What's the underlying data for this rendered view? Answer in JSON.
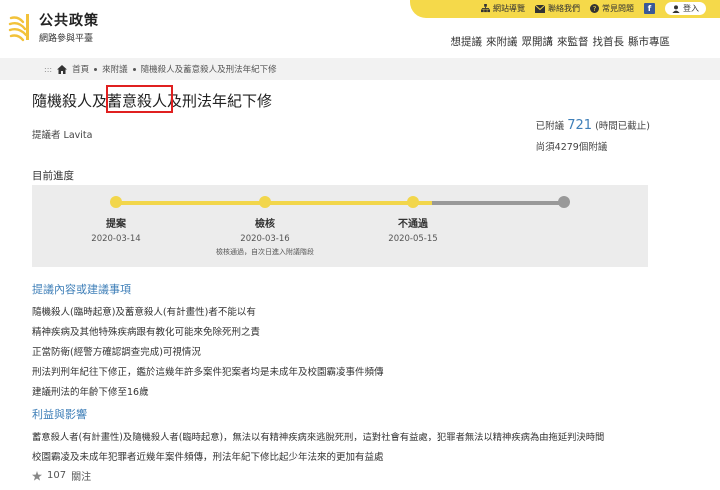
{
  "site": {
    "name_line1": "公共政策",
    "name_line2": "網路參與平臺"
  },
  "toplinks": {
    "sitemap": "網站導覽",
    "contact": "聯絡我們",
    "faq": "常見問題",
    "facebook": "f",
    "login": "登入"
  },
  "nav": [
    "想提議",
    "來附議",
    "眾開講",
    "來監督",
    "找首長",
    "縣市專區"
  ],
  "breadcrumb": {
    "prefix": ":::",
    "home": "首頁",
    "section": "來附議",
    "current": "隨機殺人及蓄意殺人及刑法年紀下修"
  },
  "title": {
    "part1": "隨機殺人及",
    "part2": "蓄意殺人",
    "part3": "及刑法年紀下修"
  },
  "proposer": "提議者 Lavita",
  "stats": {
    "prefix": "已附議",
    "count": "721",
    "suffix": "(時間已截止)",
    "needed": "尚須4279個附議"
  },
  "progress": {
    "title": "目前進度",
    "stages": [
      {
        "name": "提案",
        "date": "2020-03-14",
        "note": ""
      },
      {
        "name": "檢核",
        "date": "2020-03-16",
        "note": "檢核通過，自次日進入附議階段"
      },
      {
        "name": "不通過",
        "date": "2020-05-15",
        "note": ""
      }
    ],
    "colors": {
      "active": "#f2d64b",
      "inactive": "#999999"
    }
  },
  "content": {
    "heading": "提議內容或建議事項",
    "lines": [
      "隨機殺人(臨時起意)及蓄意殺人(有計畫性)者不能以有",
      "精神疾病及其他特殊疾病跟有教化可能來免除死刑之責",
      "正當防衛(經警方確認調查完成)可視情況",
      "刑法判刑年紀往下修正，鑑於這幾年許多案件犯案者均是未成年及校園霸凌事件頻傳",
      "建議刑法的年齡下修至16歲"
    ]
  },
  "benefits": {
    "heading": "利益與影響",
    "lines": [
      "蓄意殺人者(有計畫性)及隨機殺人者(臨時起意)，無法以有精神疾病來逃脫死刑，這對社會有益處，犯罪者無法以精神疾病為由拖延判決時間",
      "校園霸凌及未成年犯罪者近幾年案件頻傳，刑法年紀下修比起少年法來的更加有益處"
    ]
  },
  "follow": {
    "count": "107",
    "label": "關注"
  }
}
